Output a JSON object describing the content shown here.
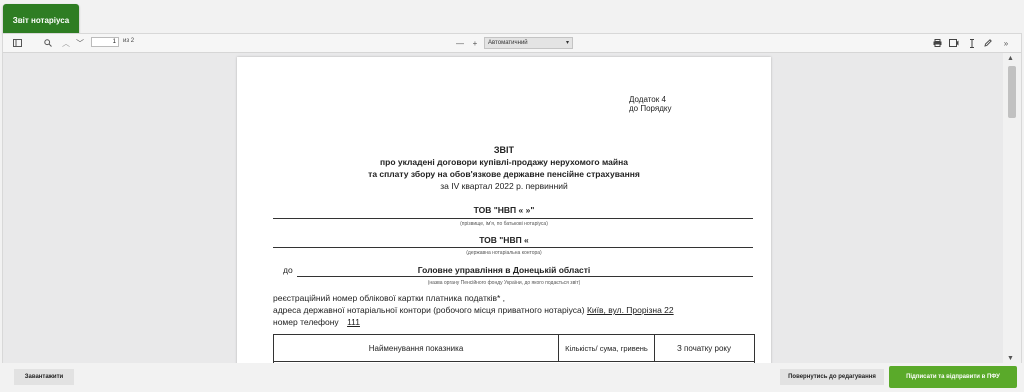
{
  "top_tab": {
    "label": "Звіт нотаріуса"
  },
  "toolbar": {
    "page_number": "1",
    "page_of": "из 2",
    "zoom_value": "Автоматичний",
    "zoom_minus": "—",
    "zoom_plus": "+"
  },
  "document": {
    "appendix_line1": "Додаток 4",
    "appendix_line2": "до Порядку",
    "title": "ЗВІТ",
    "subtitle1": "про укладені договори купівлі-продажу нерухомого майна",
    "subtitle2": "та сплату збору на обов'язкове державне пенсійне страхування",
    "subtitle3": "за IV квартал 2022 р. первинний",
    "org_name1": "ТОВ \"НВП «                    »\"",
    "caption1": "(прізвище, ім'я, по батькові нотаріуса)",
    "org_name2": "ТОВ \"НВП «                    ",
    "caption2": "(державна нотаріальна контора)",
    "to_label": "до",
    "recipient": "Головне управління в Донецькій області",
    "caption3": "(назва органу Пенсійного фонду України, до якого подається звіт)",
    "reg_number_line": "реєстраційний номер облікової картки платника податків* ,",
    "address_line_prefix": "адреса державної нотаріальної контори (робочого місця приватного нотаріуса)",
    "address_value": "Київ, вул. Прорізна 22",
    "phone_label": "номер телефону",
    "phone_value": "111",
    "table_headers": [
      "Найменування показника",
      "Кількість/ сума, гривень",
      "З початку року"
    ]
  },
  "footer": {
    "download_label": "Завантажити",
    "back_label": "Повернутись до редагування",
    "sign_label": "Підписати та відправити в ПФУ"
  }
}
